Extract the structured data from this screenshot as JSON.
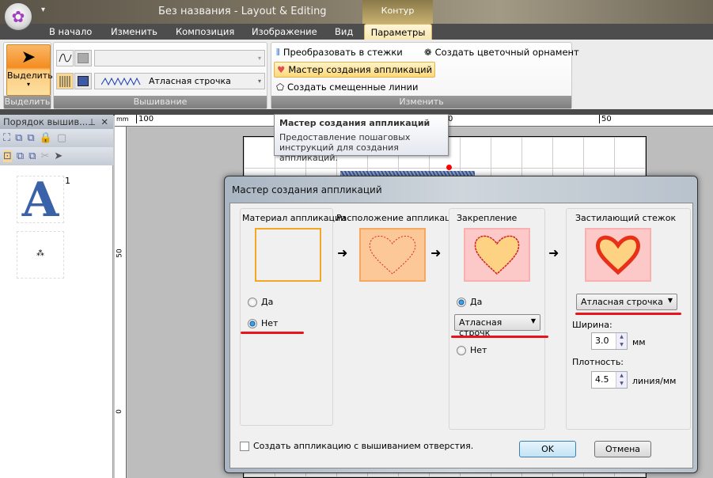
{
  "window": {
    "title": "Без названия - Layout & Editing",
    "context_tab": "Контур"
  },
  "tabs": [
    "В начало",
    "Изменить",
    "Композиция",
    "Изображение",
    "Вид",
    "Параметры"
  ],
  "ribbon": {
    "select_button": "Выделить",
    "group_select": "Выделить",
    "group_embroidery": "Вышивание",
    "stitch_combo": "Атласная строчка",
    "group_modify": "Изменить",
    "convert_to_stitches": "Преобразовать в стежки",
    "applique_wizard": "Мастер создания аппликаций",
    "offset_lines": "Создать смещенные линии",
    "flower_ornament": "Создать цветочный орнамент"
  },
  "tooltip": {
    "title": "Мастер создания аппликаций",
    "text1": "Предоставление пошаговых",
    "text2": "инструкций для создания аппликаций."
  },
  "left_panel": {
    "title": "Порядок вышив...",
    "item_number": "1"
  },
  "ruler": {
    "unit": "mm",
    "t1": "100",
    "t2": "0",
    "t3": "50",
    "l1": "50",
    "l2": "0"
  },
  "dialog": {
    "title": "Мастер создания аппликаций",
    "step1": {
      "label": "Материал аппликации",
      "yes": "Да",
      "no": "Нет",
      "selected": "Нет"
    },
    "step2": {
      "label": "Расположение аппликации"
    },
    "step3": {
      "label": "Закрепление",
      "yes": "Да",
      "combo": "Атласная строчк",
      "no": "Нет",
      "selected": "Да"
    },
    "step4": {
      "label": "Застилающий стежок",
      "combo": "Атласная строчка",
      "width_label": "Ширина:",
      "width": "3.0",
      "width_unit": "мм",
      "density_label": "Плотность:",
      "density": "4.5",
      "density_unit": "линия/мм"
    },
    "checkbox": "Создать аппликацию с вышиванием отверстия.",
    "ok": "OK",
    "cancel": "Отмена"
  },
  "colors": {
    "highlight": "#e8141c",
    "accent": "#f48c20"
  }
}
